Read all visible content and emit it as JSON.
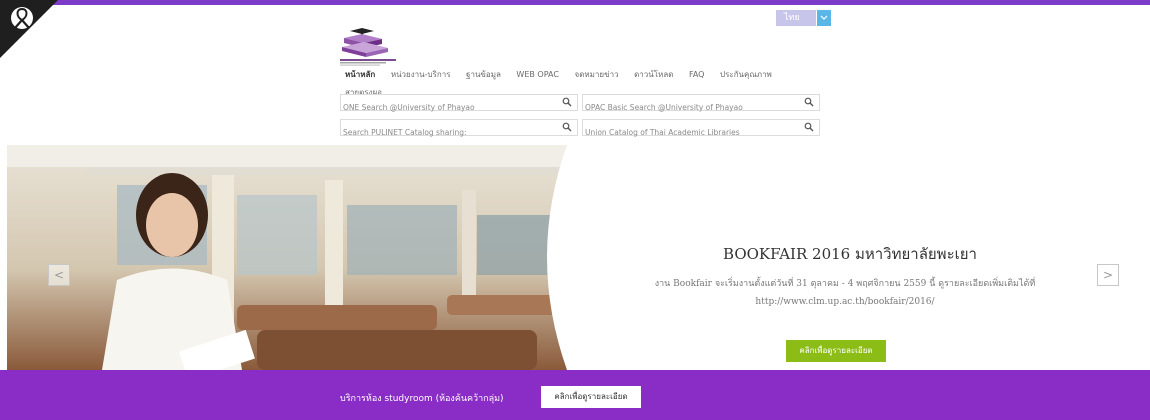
{
  "header": {
    "language": "ไทย",
    "nav": [
      "หน้าหลัก",
      "หน่วยงาน-บริการ",
      "ฐานข้อมูล",
      "WEB OPAC",
      "จดหมายข่าว",
      "ดาวน์โหลด",
      "FAQ",
      "ประกันคุณภาพ",
      "สายตรงผอ."
    ]
  },
  "search": {
    "one_search": "ONE Search @University of Phayao",
    "opac_search": "OPAC Basic Search @University of Phayao",
    "pulinet_search": "Search PULINET Catalog sharing:",
    "union_search": "Union Catalog of Thai Academic Libraries"
  },
  "slide": {
    "title": "BOOKFAIR 2016 มหาวิทยาลัยพะเยา",
    "text": "งาน Bookfair จะเริ่มงานตั้งแต่วันที่ 31 ตุลาคม - 4 พฤศจิกายน 2559 นี้ ดูรายละเอียดเพิ่มเติมได้ที่ http://www.clm.up.ac.th/bookfair/2016/",
    "button": "คลิกเพื่อดูรายละเอียด",
    "prev": "<",
    "next": ">"
  },
  "banner": {
    "text": "บริการห้อง studyroom (ห้องค้นคว้ากลุ่ม)",
    "button": "คลิกเพื่อดูรายละเอียด"
  },
  "colors": {
    "brand_purple": "#8a2dc6",
    "accent_green": "#8cbd17"
  }
}
